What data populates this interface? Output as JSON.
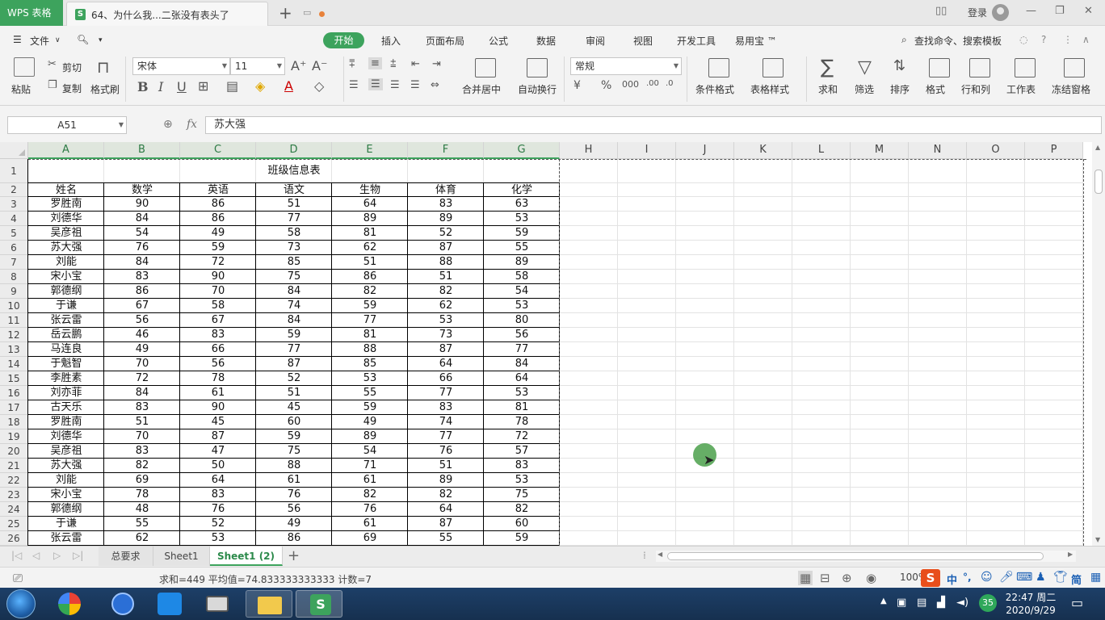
{
  "window": {
    "app_tab": "WPS 表格",
    "doc_tab": "64、为什么我...二张没有表头了",
    "login": "登录"
  },
  "menu": {
    "file": "文件",
    "tabs": [
      "开始",
      "插入",
      "页面布局",
      "公式",
      "数据",
      "审阅",
      "视图",
      "开发工具",
      "易用宝 ™"
    ],
    "search": "查找命令、搜索模板"
  },
  "ribbon": {
    "paste": "粘贴",
    "cut": "剪切",
    "copy": "复制",
    "format_painter": "格式刷",
    "font_name": "宋体",
    "font_size": "11",
    "merge_center": "合并居中",
    "wrap_text": "自动换行",
    "number_format": "常规",
    "conditional_format": "条件格式",
    "table_style": "表格样式",
    "sum": "求和",
    "filter": "筛选",
    "sort": "排序",
    "format": "格式",
    "row_col": "行和列",
    "worksheet": "工作表",
    "freeze": "冻结窗格"
  },
  "formula_bar": {
    "cell_ref": "A51",
    "fx": "fx",
    "content": "苏大强"
  },
  "sheet": {
    "columns": [
      "A",
      "B",
      "C",
      "D",
      "E",
      "F",
      "G",
      "H",
      "I",
      "J",
      "K",
      "L",
      "M",
      "N",
      "O",
      "P"
    ],
    "title": "班级信息表",
    "headers": [
      "姓名",
      "数学",
      "英语",
      "语文",
      "生物",
      "体育",
      "化学"
    ],
    "rows": [
      [
        "罗胜南",
        "90",
        "86",
        "51",
        "64",
        "83",
        "63"
      ],
      [
        "刘德华",
        "84",
        "86",
        "77",
        "89",
        "89",
        "53"
      ],
      [
        "吴彦祖",
        "54",
        "49",
        "58",
        "81",
        "52",
        "59"
      ],
      [
        "苏大强",
        "76",
        "59",
        "73",
        "62",
        "87",
        "55"
      ],
      [
        "刘能",
        "84",
        "72",
        "85",
        "51",
        "88",
        "89"
      ],
      [
        "宋小宝",
        "83",
        "90",
        "75",
        "86",
        "51",
        "58"
      ],
      [
        "郭德纲",
        "86",
        "70",
        "84",
        "82",
        "82",
        "54"
      ],
      [
        "于谦",
        "67",
        "58",
        "74",
        "59",
        "62",
        "53"
      ],
      [
        "张云雷",
        "56",
        "67",
        "84",
        "77",
        "53",
        "80"
      ],
      [
        "岳云鹏",
        "46",
        "83",
        "59",
        "81",
        "73",
        "56"
      ],
      [
        "马连良",
        "49",
        "66",
        "77",
        "88",
        "87",
        "77"
      ],
      [
        "于魁智",
        "70",
        "56",
        "87",
        "85",
        "64",
        "84"
      ],
      [
        "李胜素",
        "72",
        "78",
        "52",
        "53",
        "66",
        "64"
      ],
      [
        "刘亦菲",
        "84",
        "61",
        "51",
        "55",
        "77",
        "53"
      ],
      [
        "古天乐",
        "83",
        "90",
        "45",
        "59",
        "83",
        "81"
      ],
      [
        "罗胜南",
        "51",
        "45",
        "60",
        "49",
        "74",
        "78"
      ],
      [
        "刘德华",
        "70",
        "87",
        "59",
        "89",
        "77",
        "72"
      ],
      [
        "吴彦祖",
        "83",
        "47",
        "75",
        "54",
        "76",
        "57"
      ],
      [
        "苏大强",
        "82",
        "50",
        "88",
        "71",
        "51",
        "83"
      ],
      [
        "刘能",
        "69",
        "64",
        "61",
        "61",
        "89",
        "53"
      ],
      [
        "宋小宝",
        "78",
        "83",
        "76",
        "82",
        "82",
        "75"
      ],
      [
        "郭德纲",
        "48",
        "76",
        "56",
        "76",
        "64",
        "82"
      ],
      [
        "于谦",
        "55",
        "52",
        "49",
        "61",
        "87",
        "60"
      ],
      [
        "张云雷",
        "62",
        "53",
        "86",
        "69",
        "55",
        "59"
      ]
    ]
  },
  "sheet_tabs": [
    "总要求",
    "Sheet1",
    "Sheet1 (2)"
  ],
  "status": {
    "summary": "求和=449  平均值=74.833333333333  计数=7",
    "zoom": "100%"
  },
  "ime": {
    "lang": "中",
    "punct": "°,",
    "simplified": "简"
  },
  "taskbar": {
    "time": "22:47 周二",
    "date": "2020/9/29",
    "badge": "35"
  }
}
